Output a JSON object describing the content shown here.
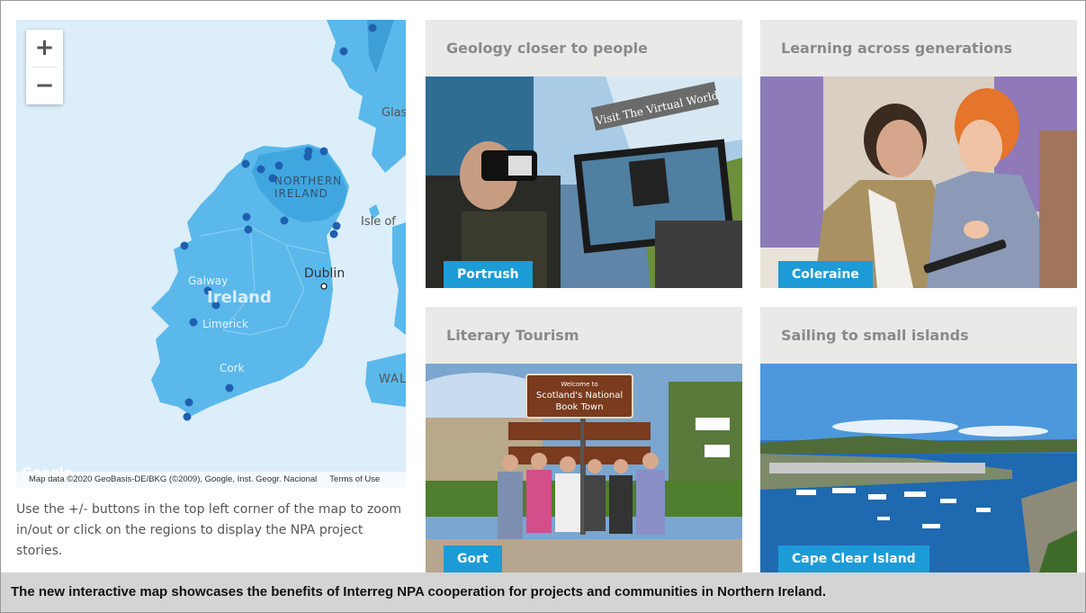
{
  "map": {
    "zoom_in_label": "+",
    "zoom_out_label": "−",
    "labels": {
      "northern_ireland": "NORTHERN IRELAND",
      "isle_of_man": "Isle of",
      "dublin": "Dublin",
      "galway": "Galway",
      "ireland": "Ireland",
      "limerick": "Limerick",
      "cork": "Cork",
      "glasgow": "Glas",
      "wales": "WAL"
    },
    "attribution": "Map data ©2020 GeoBasis-DE/BKG (©2009), Google, Inst. Geogr. Nacional",
    "terms": "Terms of Use",
    "logo": "Google",
    "colors": {
      "water": "#dbeef9",
      "land": "#5bb8ea",
      "marker": "#1f5fb0"
    }
  },
  "help_text": "Use the +/- buttons in the top left corner of the map to zoom in/out or click on the regions to display the NPA project stories.",
  "cards": [
    {
      "title": "Geology closer to people",
      "badge": "Portrush",
      "sign_text": "Visit The Virtual World"
    },
    {
      "title": "Learning across generations",
      "badge": "Coleraine"
    },
    {
      "title": "Literary Tourism",
      "badge": "Gort",
      "sign_line1": "Welcome to",
      "sign_line2": "Scotland's National",
      "sign_line3": "Book Town"
    },
    {
      "title": "Sailing to small islands",
      "badge": "Cape Clear Island"
    }
  ],
  "caption": "The new interactive map showcases the benefits of Interreg NPA cooperation for projects and communities in Northern Ireland.",
  "colors": {
    "accent": "#1d9bd7",
    "card_header": "#e9e9e7",
    "caption_bg": "#d4d4d4"
  }
}
